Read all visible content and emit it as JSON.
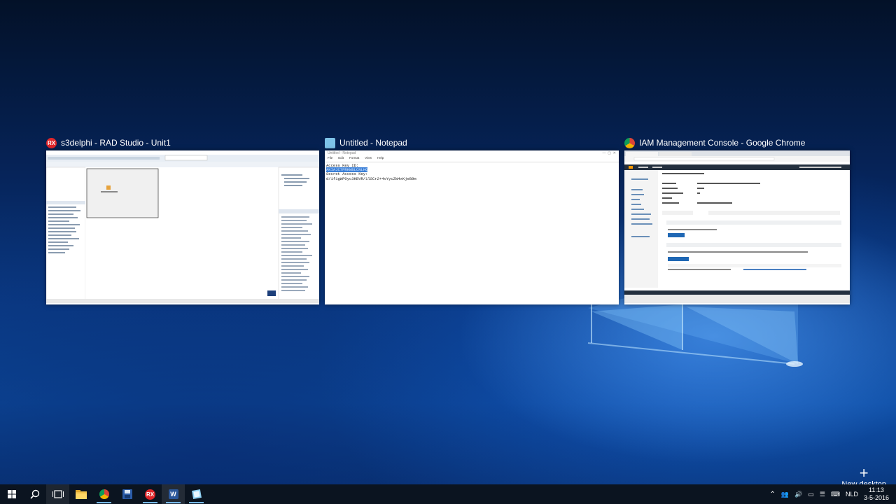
{
  "task_view": {
    "windows": [
      {
        "app": "RAD Studio",
        "icon": "rad-studio-icon",
        "icon_text": "RX",
        "title": "s3delphi - RAD Studio - Unit1"
      },
      {
        "app": "Notepad",
        "icon": "notepad-icon",
        "title": "Untitled - Notepad",
        "doc_title": "Untitled - Notepad",
        "menu": [
          "File",
          "Edit",
          "Format",
          "View",
          "Help"
        ],
        "content": {
          "line1": "Access Key ID:",
          "line2": "AKIAJC7PRKWBLCNLHQ",
          "line3": "Secret Access Key:",
          "line4": "d/1f1gWPOyc3KBVR/1lSCr2+4vYycZW4xKjeB9m"
        }
      },
      {
        "app": "Google Chrome",
        "icon": "chrome-icon",
        "title": "IAM Management Console - Google Chrome"
      }
    ],
    "new_desktop_label": "New desktop"
  },
  "taskbar": {
    "apps": [
      {
        "name": "file-explorer-icon",
        "running": false
      },
      {
        "name": "chrome-icon",
        "running": true
      },
      {
        "name": "save-app-icon",
        "running": false
      },
      {
        "name": "rad-studio-icon",
        "running": true,
        "text": "RX"
      },
      {
        "name": "word-icon",
        "running": true,
        "text": "W"
      },
      {
        "name": "notepad-icon",
        "running": true
      }
    ],
    "language": "NLD",
    "time": "11:13",
    "date": "3-5-2016"
  }
}
